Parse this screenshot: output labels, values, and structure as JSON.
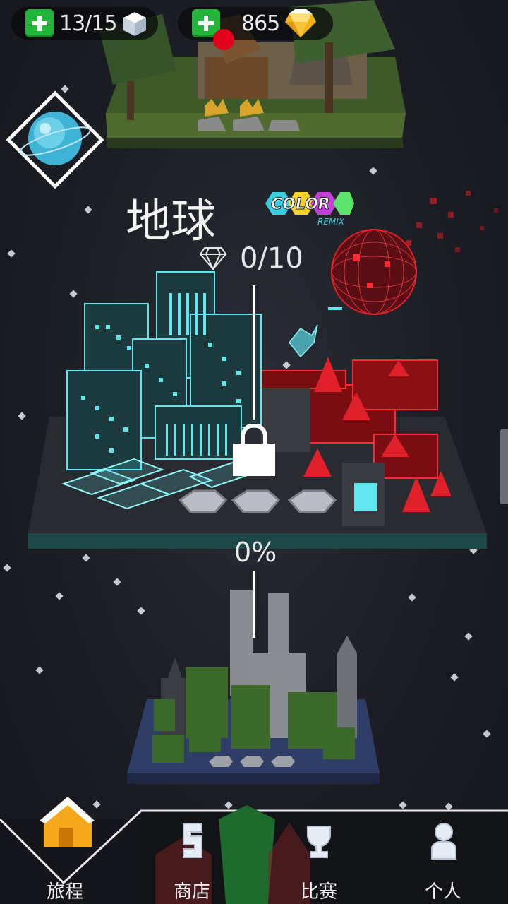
{
  "resources": {
    "cubes": "13/15",
    "gems": "865",
    "has_notification": true
  },
  "level": {
    "title": "地球",
    "badge_text": "COLOR",
    "badge_subtext": "REMIX",
    "gems_collected": "0/10",
    "progress": "0%",
    "locked": true
  },
  "nav": {
    "items": [
      {
        "label": "旅程",
        "icon": "home-icon",
        "active": true
      },
      {
        "label": "商店",
        "icon": "shop-icon",
        "active": false
      },
      {
        "label": "比赛",
        "icon": "trophy-icon",
        "active": false
      },
      {
        "label": "个人",
        "icon": "person-icon",
        "active": false
      }
    ]
  },
  "colors": {
    "accent_green": "#23b43a",
    "neon_cyan": "#5fe6ee",
    "neon_red": "#e0202a",
    "notification_red": "#e3001b"
  }
}
